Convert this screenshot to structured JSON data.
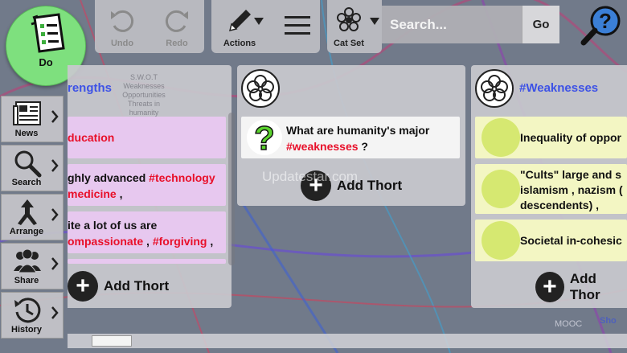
{
  "toolbar": {
    "undo_label": "Undo",
    "redo_label": "Redo",
    "actions_label": "Actions",
    "catset_label": "Cat Set",
    "search_placeholder": "Search...",
    "go_label": "Go"
  },
  "do_button": {
    "label": "Do"
  },
  "nav": {
    "items": [
      {
        "label": "News",
        "icon": "newspaper-icon"
      },
      {
        "label": "Search",
        "icon": "magnifier-icon"
      },
      {
        "label": "Arrange",
        "icon": "arrange-arrows-icon"
      },
      {
        "label": "Share",
        "icon": "people-icon"
      },
      {
        "label": "History",
        "icon": "clock-icon"
      }
    ]
  },
  "columns": {
    "strengths": {
      "title": "rengths",
      "faint_lines": [
        "S.W.O.T",
        "Weaknesses",
        "Opportunities",
        "Threats in",
        "humanity"
      ],
      "cards": [
        {
          "line1_text": "ducation",
          "line1_tags": "",
          "line2_text": "",
          "line2_tags": ""
        },
        {
          "line1_text": "ghly advanced ",
          "line1_tags": "#technology",
          "line2_text": "",
          "line2_tags": "medicine",
          "line2_suffix": " ,"
        },
        {
          "line1_text": "ite a lot of us are",
          "line1_tags": "",
          "line2_text": "",
          "line2_tags": "ompassionate",
          "line2_mid": " , ",
          "line2_tags2": "#forgiving",
          "line2_suffix": " ,"
        }
      ],
      "add_label": "Add Thort"
    },
    "middle": {
      "question_text": "What are humanity's major",
      "question_tag": "#weaknesses",
      "question_suffix": " ?",
      "add_label": "Add Thort",
      "watermark": "Updatestar.com"
    },
    "weaknesses": {
      "title": "#Weaknesses",
      "cards": [
        {
          "line1": "Inequality of oppor",
          "line2": ""
        },
        {
          "line1": "\"Cults\" large and s",
          "line2": "islamism , nazism (",
          "line3": "descendents) ,"
        },
        {
          "line1": "Societal in-cohesic",
          "line2": ""
        }
      ],
      "add_label": "Add Thor",
      "faint_lines": [
        "MOOC",
        "Sho"
      ]
    }
  },
  "colors": {
    "accent_blue": "#3d52e6",
    "tag_red": "#e8102a",
    "do_green": "#7ee07e",
    "pink_card": "#e7c8ef",
    "yellow_card": "#f3f6c3",
    "yellow_dot": "#d6e871",
    "question_green": "#5bd32e"
  }
}
